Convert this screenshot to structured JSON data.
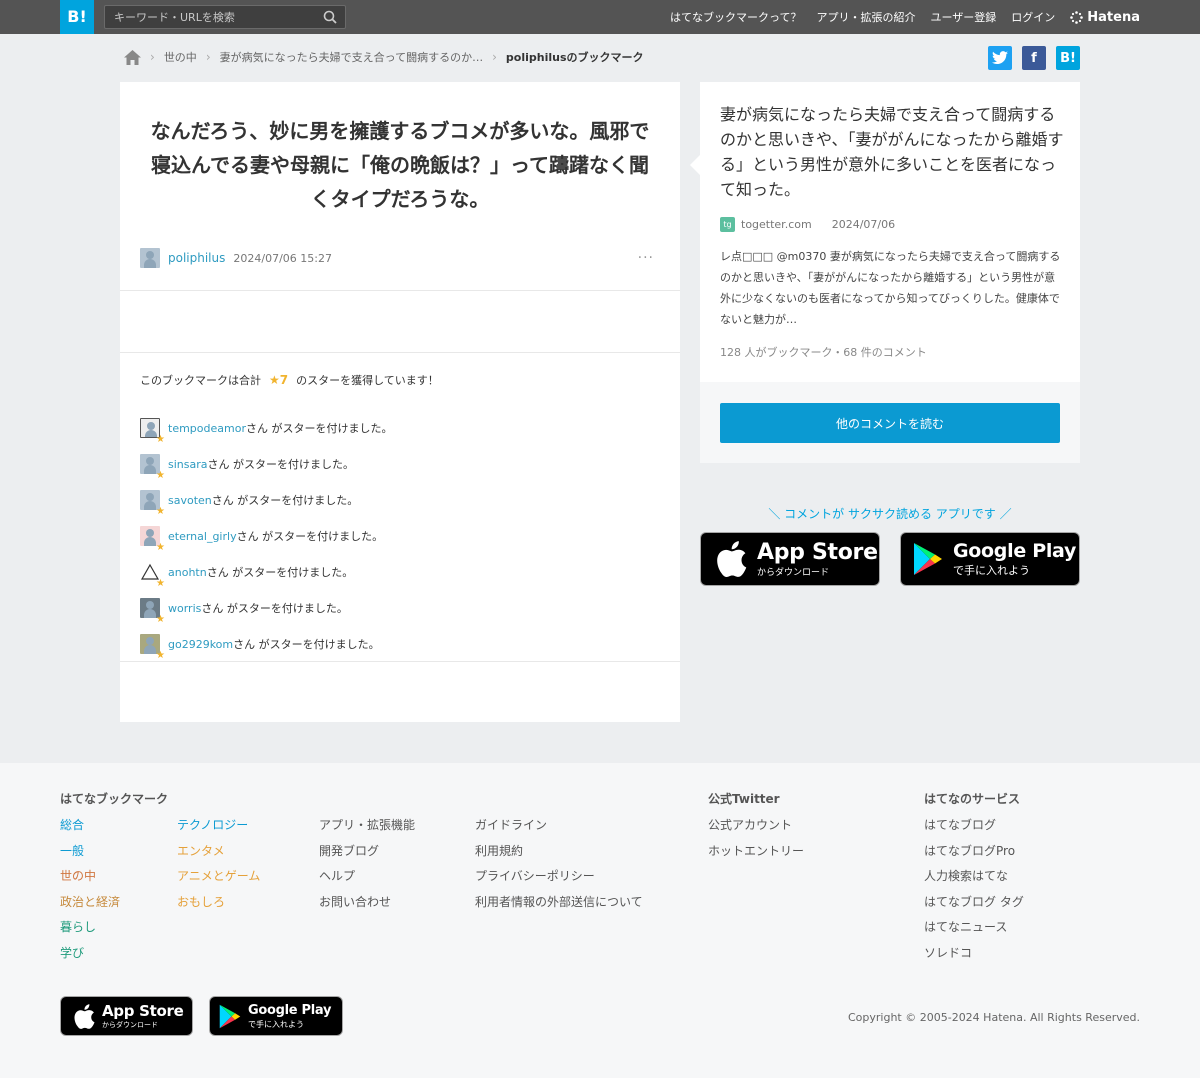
{
  "header": {
    "logo": "B!",
    "search_placeholder": "キーワード・URLを検索",
    "nav": [
      "はてなブックマークって？",
      "アプリ・拡張の紹介",
      "ユーザー登録",
      "ログイン"
    ],
    "brand": "Hatena"
  },
  "breadcrumb": {
    "items": [
      "世の中",
      "妻が病気になったら夫婦で支え合って闘病するのか…",
      "poliphilusのブックマーク"
    ]
  },
  "share": {
    "twitter": "t",
    "facebook": "f",
    "hatena": "B!"
  },
  "bookmark": {
    "comment": "なんだろう、妙に男を擁護するブコメが多いな。風邪で寝込んでる妻や母親に「俺の晩飯は？」って躊躇なく聞くタイプだろうな。",
    "user": "poliphilus",
    "date": "2024/07/06 15:27",
    "more": "···"
  },
  "stars": {
    "summary_before": "このブックマークは合計",
    "count": "★7",
    "summary_after": "のスターを獲得しています！",
    "suffix": "さん がスターを付けました。",
    "users": [
      "tempodeamor",
      "sinsara",
      "savoten",
      "eternal_girly",
      "anohtn",
      "worris",
      "go2929kom"
    ]
  },
  "entry": {
    "title": "妻が病気になったら夫婦で支え合って闘病するのかと思いきや、「妻ががんになったから離婚する」という男性が意外に多いことを医者になって知った。",
    "domain": "togetter.com",
    "date": "2024/07/06",
    "description": "レ点□□□ @m0370 妻が病気になったら夫婦で支え合って闘病するのかと思いきや、「妻ががんになったから離婚する」という男性が意外に少なくないのも医者になってから知ってびっくりした。健康体でないと魅力が…",
    "stats": "128 人がブックマーク・68 件のコメント",
    "read_more": "他のコメントを読む"
  },
  "apps": {
    "tagline": "＼ コメントが サクサク読める アプリです ／",
    "appstore_big": "App Store",
    "appstore_small": "からダウンロード",
    "googleplay_big": "Google Play",
    "googleplay_small": "で手に入れよう"
  },
  "footer": {
    "col1_title": "はてなブックマーク",
    "categories_a": [
      "総合",
      "一般",
      "世の中",
      "政治と経済",
      "暮らし",
      "学び"
    ],
    "categories_b": [
      "テクノロジー",
      "エンタメ",
      "アニメとゲーム",
      "おもしろ"
    ],
    "links_a": [
      "アプリ・拡張機能",
      "開発ブログ",
      "ヘルプ",
      "お問い合わせ"
    ],
    "links_b": [
      "ガイドライン",
      "利用規約",
      "プライバシーポリシー",
      "利用者情報の外部送信について"
    ],
    "twitter_title": "公式Twitter",
    "twitter_links": [
      "公式アカウント",
      "ホットエントリー"
    ],
    "services_title": "はてなのサービス",
    "services": [
      "はてなブログ",
      "はてなブログPro",
      "人力検索はてな",
      "はてなブログ タグ",
      "はてなニュース",
      "ソレドコ"
    ],
    "copyright": "Copyright © 2005-2024 Hatena. All Rights Reserved."
  },
  "colors": {
    "accent": "#00a4de",
    "star": "#f1b42f",
    "header_bg": "#545454"
  }
}
